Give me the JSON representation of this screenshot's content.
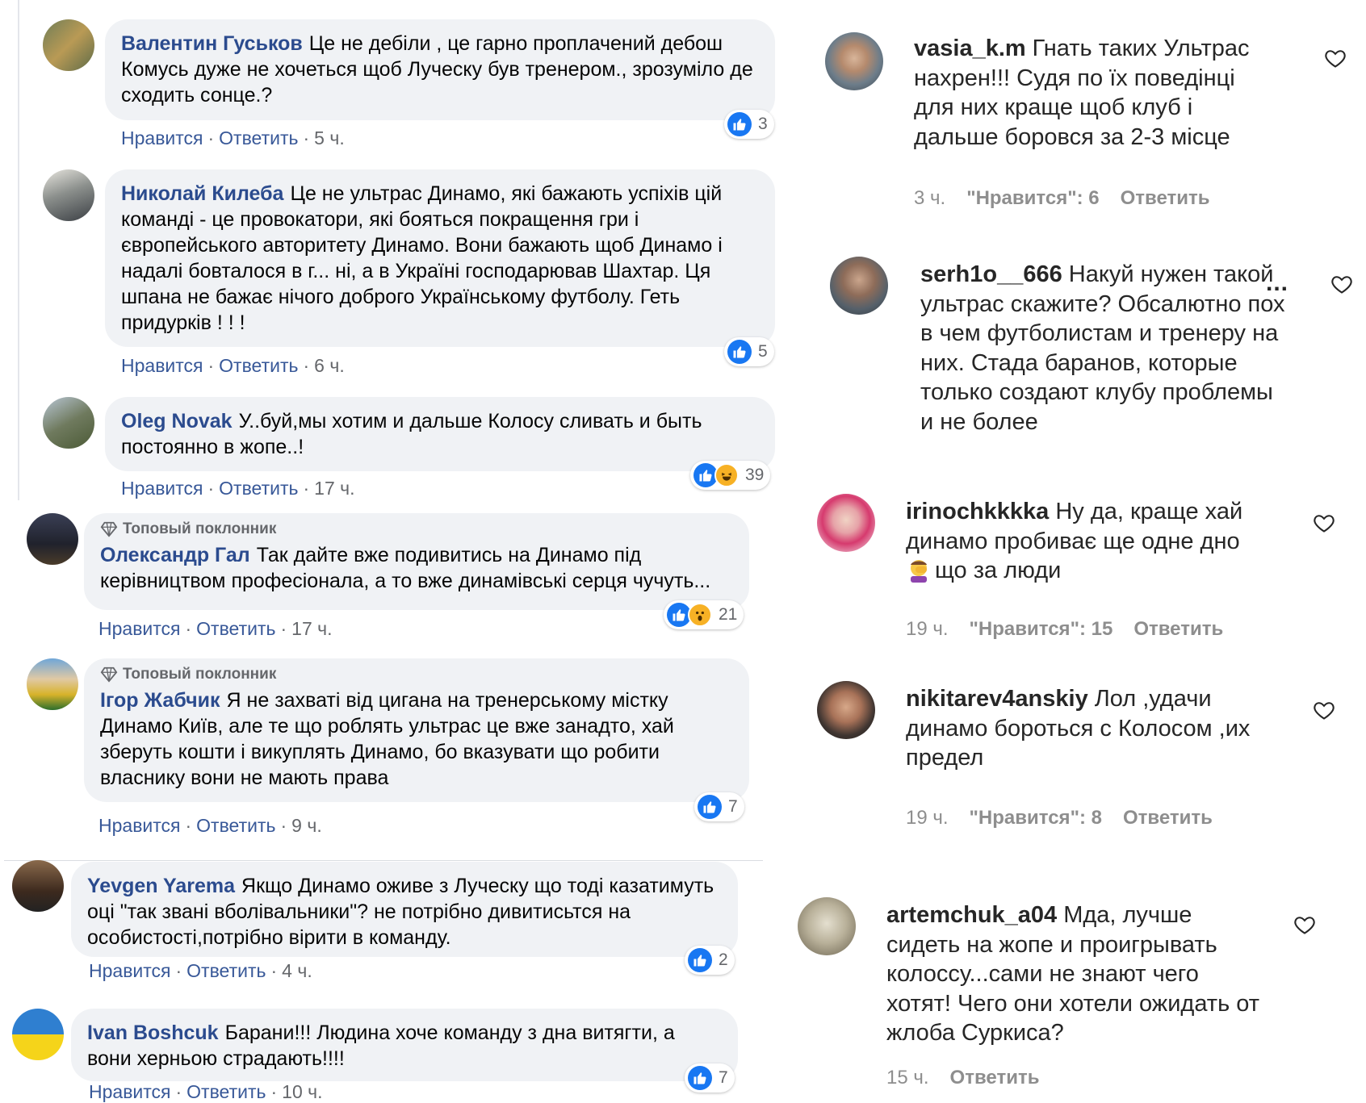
{
  "colors": {
    "fb_name": "#2b4b8e",
    "fb_link": "#385898",
    "fb_bubble": "#f0f2f5",
    "fb_like": "#1877f2",
    "ig_text": "#262626",
    "ig_meta": "#8e8e8e"
  },
  "facebook": {
    "like_label": "Нравится",
    "reply_label": "Ответить",
    "badge_label": "Топовый поклонник",
    "comments": [
      {
        "author": "Валентин Гуськов",
        "text": "Це не дебіли , це гарно проплачений дебош Комусь дуже не хочеться щоб Луческу був тренером., зрозуміло де сходить сонце.?",
        "time": "5 ч.",
        "reactions": [
          "like"
        ],
        "count": "3"
      },
      {
        "author": "Николай Килеба",
        "text": "Це не ультрас Динамо, які бажають успіхів цій команді - це провокатори, які бояться покращення гри і європейського авторитету Динамо. Вони бажають щоб Динамо і надалі бовталося в г... ні, а в Україні господарював Шахтар. Ця шпана не бажає нічого доброго Українському футболу. Геть придурків ! ! !",
        "time": "6 ч.",
        "reactions": [
          "like"
        ],
        "count": "5"
      },
      {
        "author": "Oleg Novak",
        "text": "У..буй,мы хотим и дальше Колосу сливать и быть постоянно в жопе..!",
        "time": "17 ч.",
        "reactions": [
          "like",
          "haha"
        ],
        "count": "39"
      },
      {
        "author": "Олександр Гал",
        "badge": true,
        "text": "Так дайте вже подивитись на Динамо під керівництвом професіонала, а то вже динамівські серця чучуть...",
        "time": "17 ч.",
        "reactions": [
          "like",
          "wow"
        ],
        "count": "21"
      },
      {
        "author": "Ігор Жабчик",
        "badge": true,
        "text": "Я не захваті від цигана на тренерському містку Динамо Київ, але те що роблять ультрас це вже занадто, хай зберуть кошти і викуплять Динамо, бо вказувати що робити власнику вони не мають права",
        "time": "9 ч.",
        "reactions": [
          "like"
        ],
        "count": "7"
      },
      {
        "author": "Yevgen Yarema",
        "text": "Якщо Динамо оживе з Луческу що тоді казатимуть оці \"так звані вболівальники\"? не потрібно дивитисьтся на особистості,потрібно вірити в команду.",
        "time": "4 ч.",
        "reactions": [
          "like"
        ],
        "count": "2"
      },
      {
        "author": "Ivan Boshcuk",
        "text": "Барани!!! Людина хоче команду з дна витягти, а вони херньою страдають!!!!",
        "time": "10 ч.",
        "reactions": [
          "like"
        ],
        "count": "7"
      }
    ]
  },
  "instagram": {
    "likes_prefix": "\"Нравится\": ",
    "reply_label": "Ответить",
    "comments": [
      {
        "username": "vasia_k.m",
        "text": "Гнать таких Ультрас нахрен!!! Судя по їх поведінці для них краще щоб клуб і дальше боровся за 2-3 місце",
        "time": "3 ч.",
        "likes": "6"
      },
      {
        "username": "serh1o__666",
        "text": "Накуй нужен такой ультрас скажите? Обсалютно пох в чем футболистам и тренеру на них. Стада баранов, которые только создают клубу проблемы и не более",
        "more": "...",
        "time": "",
        "likes": ""
      },
      {
        "username": "irinochkkkka",
        "text": "Ну да, краще хай динамо пробиває ще одне дно",
        "text2": "що за люди",
        "time": "19 ч.",
        "likes": "15"
      },
      {
        "username": "nikitarev4anskiy",
        "text": "Лол ,удачи динамо бороться с Колосом ,их предел",
        "time": "19 ч.",
        "likes": "8"
      },
      {
        "username": "artemchuk_a04",
        "text": "Мда, лучше сидеть на жопе и проигрывать колоссу...сами не знают чего хотят! Чего они хотели ожидать от жлоба Суркиса?",
        "time": "15 ч.",
        "likes": ""
      }
    ]
  }
}
